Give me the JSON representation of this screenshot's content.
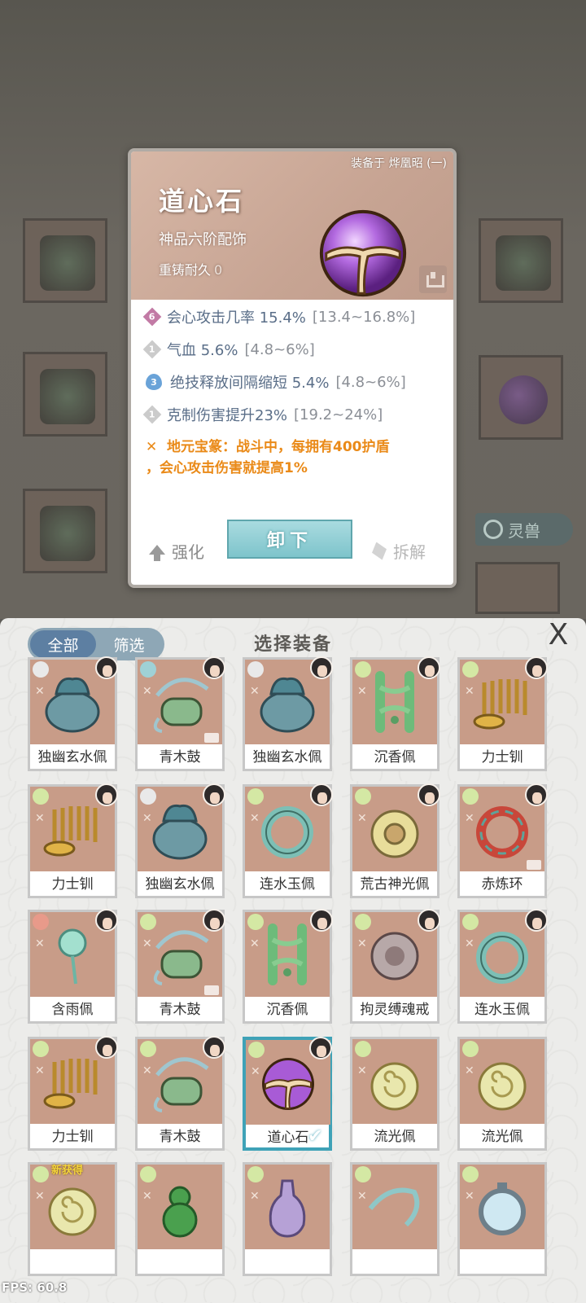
{
  "detail": {
    "equipped_on": "装备于 烨凰昭 (一)",
    "name": "道心石",
    "grade": "神品六阶配饰",
    "reforge_label": "重铸耐久",
    "reforge_value": "0",
    "stats": [
      {
        "badge": "6",
        "badge_type": "rhombus",
        "label": "会心攻击几率 15.4%",
        "range": "[13.4~16.8%]"
      },
      {
        "badge": "1",
        "badge_type": "grey",
        "label": "气血 5.6%",
        "range": "[4.8~6%]"
      },
      {
        "badge": "3",
        "badge_type": "drop",
        "label": "绝技释放间隔缩短 5.4%",
        "range": "[4.8~6%]"
      },
      {
        "badge": "1",
        "badge_type": "grey",
        "label": "克制伤害提升23%",
        "range": "[19.2~24%]"
      }
    ],
    "set_bonus_line1": "地元宝篆：战斗中，每拥有400护盾",
    "set_bonus_line2": "，会心攻击伤害就提高1%",
    "enhance_label": "强化",
    "unequip_label": "卸下",
    "dismantle_label": "拆解"
  },
  "background": {
    "lingshou_label": "灵兽"
  },
  "panel": {
    "tab_all": "全部",
    "tab_filter": "筛选",
    "title": "选择装备",
    "close_icon": "X"
  },
  "items": [
    {
      "name": "独幽玄水佩",
      "qual": "#e9e9e9",
      "art": "blue-vase",
      "avatar": true,
      "lock": false
    },
    {
      "name": "青木鼓",
      "qual": "#9fd1d6",
      "art": "drum",
      "avatar": true,
      "lock": true
    },
    {
      "name": "独幽玄水佩",
      "qual": "#e9e9e9",
      "art": "blue-vase",
      "avatar": true,
      "lock": false
    },
    {
      "name": "沉香佩",
      "qual": "#d4e8a4",
      "art": "green-pendant",
      "avatar": true,
      "lock": false
    },
    {
      "name": "力士钏",
      "qual": "#d4e8a4",
      "art": "gold-coil",
      "avatar": true,
      "lock": false
    },
    {
      "name": "力士钏",
      "qual": "#d4e8a4",
      "art": "gold-coil",
      "avatar": true,
      "lock": false
    },
    {
      "name": "独幽玄水佩",
      "qual": "#e9e9e9",
      "art": "blue-vase",
      "avatar": true,
      "lock": false
    },
    {
      "name": "连水玉佩",
      "qual": "#d4e8a4",
      "art": "jade-ring",
      "avatar": true,
      "lock": false
    },
    {
      "name": "荒古神光佩",
      "qual": "#d4e8a4",
      "art": "gold-disc",
      "avatar": true,
      "lock": false
    },
    {
      "name": "赤炼环",
      "qual": "#d4e8a4",
      "art": "red-ring",
      "avatar": true,
      "lock": true
    },
    {
      "name": "含雨佩",
      "qual": "#e89a8a",
      "art": "rain-pendant",
      "avatar": true,
      "lock": false
    },
    {
      "name": "青木鼓",
      "qual": "#d4e8a4",
      "art": "drum",
      "avatar": true,
      "lock": true
    },
    {
      "name": "沉香佩",
      "qual": "#d4e8a4",
      "art": "green-pendant",
      "avatar": true,
      "lock": false
    },
    {
      "name": "拘灵缚魂戒",
      "qual": "#d4e8a4",
      "art": "dragon-ring",
      "avatar": true,
      "lock": false
    },
    {
      "name": "连水玉佩",
      "qual": "#d4e8a4",
      "art": "jade-ring",
      "avatar": true,
      "lock": false
    },
    {
      "name": "力士钏",
      "qual": "#d4e8a4",
      "art": "gold-coil",
      "avatar": true,
      "lock": false
    },
    {
      "name": "青木鼓",
      "qual": "#d4e8a4",
      "art": "drum",
      "avatar": true,
      "lock": false
    },
    {
      "name": "道心石",
      "qual": "#d4e8a4",
      "art": "purple-orb",
      "avatar": true,
      "lock": false,
      "selected": true
    },
    {
      "name": "流光佩",
      "qual": "#d4e8a4",
      "art": "gold-swirl",
      "avatar": false,
      "lock": false
    },
    {
      "name": "流光佩",
      "qual": "#d4e8a4",
      "art": "gold-swirl",
      "avatar": false,
      "lock": false
    },
    {
      "name": "",
      "qual": "#d4e8a4",
      "art": "gold-swirl",
      "avatar": false,
      "lock": false,
      "new_tag": "新获得"
    },
    {
      "name": "",
      "qual": "#d4e8a4",
      "art": "gourd",
      "avatar": false,
      "lock": false
    },
    {
      "name": "",
      "qual": "#d4e8a4",
      "art": "vase-purple",
      "avatar": false,
      "lock": false
    },
    {
      "name": "",
      "qual": "#d4e8a4",
      "art": "vine",
      "avatar": false,
      "lock": false
    },
    {
      "name": "",
      "qual": "#d4e8a4",
      "art": "mirror",
      "avatar": false,
      "lock": false
    }
  ],
  "fps_text": "FPS: 60.8",
  "colors": {
    "accent_teal": "#3fa2b7",
    "set_bonus_orange": "#ea8a18",
    "stat_blue": "#5a6e88"
  }
}
